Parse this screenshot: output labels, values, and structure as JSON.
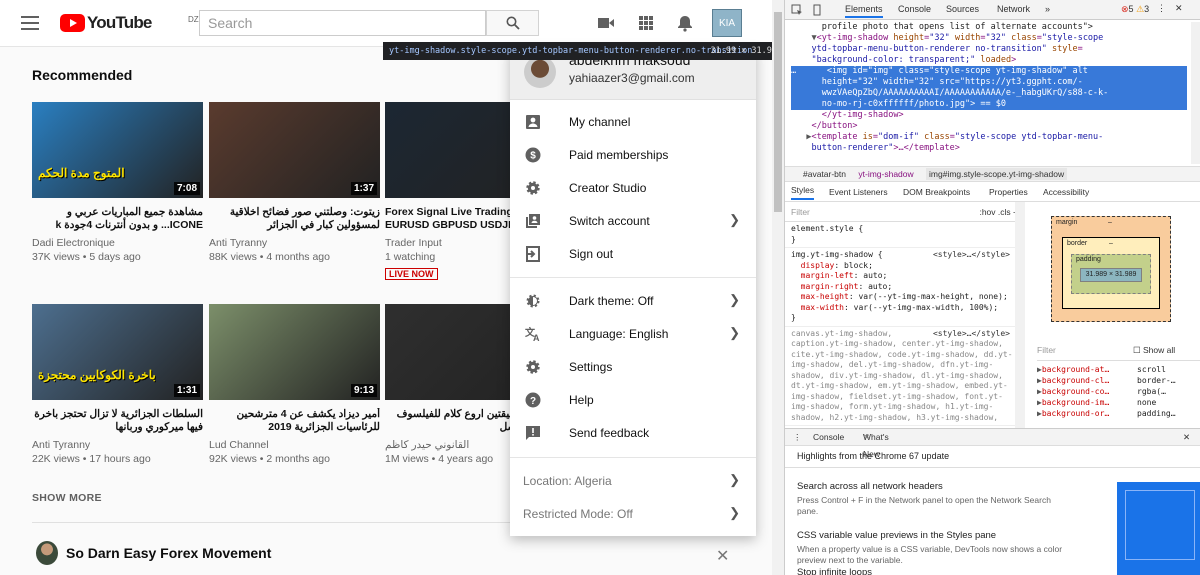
{
  "youtube": {
    "logo": "YouTube",
    "country": "DZ",
    "search_placeholder": "Search",
    "sections": {
      "recommended": "Recommended",
      "show_more": "SHOW MORE"
    },
    "videos": [
      {
        "title": "مشاهدة جميع المباريات عربي و ICONE... و بدون أنترنات 4جودة k",
        "channel": "Dadi Electronique",
        "meta": "37K views • 5 days ago",
        "duration": "7:08",
        "thumb": "#2a7fc1",
        "overlay": "المتوج مدة الحكم"
      },
      {
        "title": "زيتوت: وصلتني صور فضائح اخلاقية لمسؤولين كبار في الجزائر",
        "channel": "Anti Tyranny",
        "meta": "88K views • 4 months ago",
        "duration": "1:37",
        "thumb": "#5a3b2e"
      },
      {
        "title": "Forex Signal Live Trading EURUSD GBPUSD USDJPY",
        "channel": "Trader Input",
        "meta": "1 watching",
        "live": "LIVE NOW",
        "thumb": "#1c2733"
      },
      {
        "title": "السلطات الجزائرية لا تزال تحتجز باخرة فيها ميركوري وربانها",
        "channel": "Anti Tyranny",
        "meta": "22K views • 17 hours ago",
        "duration": "1:31",
        "thumb": "#4d6f8f",
        "overlay": "باخرة الكوكايين محتجزة"
      },
      {
        "title": "أمير ديزاد يكشف عن 4 مترشحين للرئاسيات الجزائرية 2019",
        "channel": "Lud Channel",
        "meta": "92K views • 2 months ago",
        "duration": "9:13",
        "thumb": "#7c8f6a"
      },
      {
        "title": "...اة في دقيقتين اروع كلام للفيلسوف برتراند راسل",
        "channel": "القانوني حيدر كاظم",
        "meta": "1M views • 4 years ago",
        "duration": "",
        "thumb": "#2f2f2f"
      }
    ],
    "shelf": {
      "title": "So Darn Easy Forex Movement"
    },
    "tooltip": {
      "selector": "yt-img-shadow.style-scope.ytd-topbar-menu-button-renderer.no-transition",
      "size": "31.99 × 31.99"
    },
    "avatar_text": "KIA"
  },
  "menu": {
    "name": "abdelkrim maksoud",
    "email": "yahiaazer3@gmail.com",
    "items": [
      {
        "label": "My channel",
        "icon": "person-icon"
      },
      {
        "label": "Paid memberships",
        "icon": "dollar-icon"
      },
      {
        "label": "Creator Studio",
        "icon": "gear-icon"
      },
      {
        "label": "Switch account",
        "icon": "switch-account-icon",
        "chevron": true
      },
      {
        "label": "Sign out",
        "icon": "sign-out-icon"
      }
    ],
    "items2": [
      {
        "label": "Dark theme: Off",
        "icon": "dark-theme-icon",
        "chevron": true
      },
      {
        "label": "Language: English",
        "icon": "translate-icon",
        "chevron": true
      },
      {
        "label": "Settings",
        "icon": "settings-icon"
      },
      {
        "label": "Help",
        "icon": "help-icon"
      },
      {
        "label": "Send feedback",
        "icon": "feedback-icon"
      }
    ],
    "footer": [
      {
        "label": "Location: Algeria"
      },
      {
        "label": "Restricted Mode: Off"
      }
    ]
  },
  "devtools": {
    "tabs": [
      "Elements",
      "Console",
      "Sources",
      "Network"
    ],
    "errors": "5",
    "warnings": "3",
    "breadcrumbs": [
      "#avatar-btn",
      "yt-img-shadow",
      "img#img.style-scope.yt-img-shadow"
    ],
    "subtabs": [
      "Styles",
      "Event Listeners",
      "DOM Breakpoints",
      "Properties",
      "Accessibility"
    ],
    "filter_placeholder": "Filter",
    "filter_hov": ":hov",
    "filter_cls": ".cls",
    "box": {
      "margin": "margin",
      "border": "border",
      "padding": "padding",
      "content": "31.989 × 31.989",
      "dash": "–"
    },
    "computed_filter": "Filter",
    "show_all": "Show all",
    "computed": [
      {
        "prop": "background-at…",
        "val": "scroll"
      },
      {
        "prop": "background-cl…",
        "val": "border-…"
      },
      {
        "prop": "background-co…",
        "val": "rgba(…"
      },
      {
        "prop": "background-im…",
        "val": "none"
      },
      {
        "prop": "background-or…",
        "val": "padding…"
      }
    ],
    "drawer_tabs": [
      "Console",
      "What's New"
    ],
    "whats_new_header": "Highlights from the Chrome 67 update",
    "news": [
      {
        "title": "Search across all network headers",
        "desc": "Press Control + F in the Network panel to open the Network Search pane."
      },
      {
        "title": "CSS variable value previews in the Styles pane",
        "desc": "When a property value is a CSS variable, DevTools now shows a color preview next to the variable."
      },
      {
        "title": "Stop infinite loops",
        "desc": ""
      }
    ]
  }
}
